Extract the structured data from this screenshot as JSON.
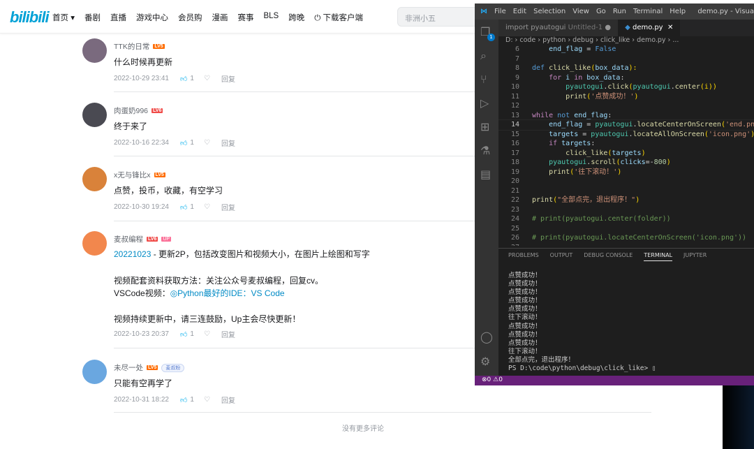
{
  "header": {
    "logo": "bilibili",
    "nav": [
      "首页 ▾",
      "番剧",
      "直播",
      "游戏中心",
      "会员购",
      "漫画",
      "赛事",
      "BLS",
      "跨晚",
      "⏻ 下载客户端"
    ],
    "search_placeholder": "非洲小五"
  },
  "comments": [
    {
      "user": "TTK的日常",
      "level": "LV5",
      "text": [
        "什么时候再更新"
      ],
      "time": "2022-10-29 23:41",
      "likes": "1",
      "reply": "回复",
      "avatar_color": "#7a6a7e"
    },
    {
      "user": "肉蛋奶996",
      "level": "LV6",
      "text": [
        "终于来了"
      ],
      "time": "2022-10-16 22:34",
      "likes": "1",
      "reply": "回复",
      "avatar_color": "#4a4a52"
    },
    {
      "user": "x无与锋比x",
      "level": "LV5",
      "text": [
        "点赞，投币，收藏，有空学习"
      ],
      "time": "2022-10-30 19:24",
      "likes": "1",
      "reply": "回复",
      "avatar_color": "#d9823a"
    },
    {
      "user": "麦叔编程",
      "level": "LV6",
      "badge": "UP",
      "text_link": "20221023",
      "text_rest": " - 更新2P，包括改变图片和视频大小，在图片上绘图和写字",
      "line2": "视频配套资料获取方法：关注公众号麦叔编程，回复cv。",
      "line3_prefix": "VSCode视频：",
      "line3_link": "◎Python最好的IDE：VS Code",
      "line4": "视频持续更新中，请三连鼓励，Up主会尽快更新！",
      "time": "2022-10-23 20:37",
      "likes": "1",
      "reply": "回复",
      "avatar_color": "#f2874d"
    },
    {
      "user": "未尽一处",
      "level": "LV5",
      "fan_badge": "麦叔粉",
      "text": [
        "只能有空再学了"
      ],
      "time": "2022-10-31 18:22",
      "likes": "1",
      "reply": "回复",
      "avatar_color": "#6aa7e0"
    }
  ],
  "no_more": "没有更多评论",
  "vscode": {
    "menu": [
      "File",
      "Edit",
      "Selection",
      "View",
      "Go",
      "Run",
      "Terminal",
      "Help"
    ],
    "title": "demo.py - Visua",
    "tabs": [
      {
        "label": "import pyautogui",
        "sub": "Untitled-1",
        "dirty": true
      },
      {
        "label": "demo.py",
        "active": true
      }
    ],
    "breadcrumb": "D: › code › python › debug › click_like › demo.py › ...",
    "explorer_badge": "1",
    "code": [
      {
        "n": "6",
        "t": [
          [
            "    end_flag",
            "vr"
          ],
          [
            " = ",
            "pl"
          ],
          [
            "False",
            "df"
          ]
        ]
      },
      {
        "n": "7",
        "t": []
      },
      {
        "n": "8",
        "t": [
          [
            "def ",
            "df"
          ],
          [
            "click_like",
            "fn"
          ],
          [
            "(",
            "br"
          ],
          [
            "box_data",
            "vr"
          ],
          [
            "):",
            "br"
          ]
        ]
      },
      {
        "n": "9",
        "t": [
          [
            "    for ",
            "kw"
          ],
          [
            "i ",
            "vr"
          ],
          [
            "in ",
            "kw"
          ],
          [
            "box_data",
            "vr"
          ],
          [
            ":",
            "pl"
          ]
        ]
      },
      {
        "n": "10",
        "t": [
          [
            "        pyautogui",
            "cn"
          ],
          [
            ".",
            "pl"
          ],
          [
            "click",
            "fn"
          ],
          [
            "(",
            "br"
          ],
          [
            "pyautogui",
            "cn"
          ],
          [
            ".",
            "pl"
          ],
          [
            "center",
            "fn"
          ],
          [
            "(i))",
            "br"
          ]
        ]
      },
      {
        "n": "11",
        "t": [
          [
            "        print",
            "fn"
          ],
          [
            "(",
            "br"
          ],
          [
            "'点赞成功！'",
            "st"
          ],
          [
            ")",
            "br"
          ]
        ]
      },
      {
        "n": "12",
        "t": []
      },
      {
        "n": "13",
        "t": [
          [
            "while ",
            "kw"
          ],
          [
            "not ",
            "df"
          ],
          [
            "end_flag",
            "vr"
          ],
          [
            ":",
            "pl"
          ]
        ]
      },
      {
        "n": "14",
        "cur": true,
        "t": [
          [
            "    end_flag",
            "vr"
          ],
          [
            " = ",
            "pl"
          ],
          [
            "pyautogui",
            "cn"
          ],
          [
            ".",
            "pl"
          ],
          [
            "locateCenterOnScreen",
            "fn"
          ],
          [
            "(",
            "br"
          ],
          [
            "'end.png'",
            "st"
          ],
          [
            ")",
            "br"
          ]
        ]
      },
      {
        "n": "15",
        "t": [
          [
            "    targets",
            "vr"
          ],
          [
            " = ",
            "pl"
          ],
          [
            "pyautogui",
            "cn"
          ],
          [
            ".",
            "pl"
          ],
          [
            "locateAllOnScreen",
            "fn"
          ],
          [
            "(",
            "br"
          ],
          [
            "'icon.png'",
            "st"
          ],
          [
            ")",
            "br"
          ]
        ]
      },
      {
        "n": "16",
        "t": [
          [
            "    if ",
            "kw"
          ],
          [
            "targets",
            "vr"
          ],
          [
            ":",
            "pl"
          ]
        ]
      },
      {
        "n": "17",
        "t": [
          [
            "        click_like",
            "fn"
          ],
          [
            "(",
            "br"
          ],
          [
            "targets",
            "vr"
          ],
          [
            ")",
            "br"
          ]
        ]
      },
      {
        "n": "18",
        "t": [
          [
            "    pyautogui",
            "cn"
          ],
          [
            ".",
            "pl"
          ],
          [
            "scroll",
            "fn"
          ],
          [
            "(",
            "br"
          ],
          [
            "clicks",
            "vr"
          ],
          [
            "=-",
            "pl"
          ],
          [
            "800",
            "nu"
          ],
          [
            ")",
            "br"
          ]
        ]
      },
      {
        "n": "19",
        "t": [
          [
            "    print",
            "fn"
          ],
          [
            "(",
            "br"
          ],
          [
            "'往下滚动！'",
            "st"
          ],
          [
            ")",
            "br"
          ]
        ]
      },
      {
        "n": "20",
        "t": []
      },
      {
        "n": "21",
        "t": []
      },
      {
        "n": "22",
        "t": [
          [
            "print",
            "fn"
          ],
          [
            "(",
            "br"
          ],
          [
            "\"全部点完，退出程序！\"",
            "st"
          ],
          [
            ")",
            "br"
          ]
        ]
      },
      {
        "n": "23",
        "t": []
      },
      {
        "n": "24",
        "t": [
          [
            "# print(pyautogui.center(folder))",
            "cm2"
          ]
        ]
      },
      {
        "n": "25",
        "t": []
      },
      {
        "n": "26",
        "t": [
          [
            "# print(pyautogui.locateCenterOnScreen('icon.png'))",
            "cm2"
          ]
        ]
      },
      {
        "n": "27",
        "t": []
      }
    ],
    "panel_tabs": [
      "PROBLEMS",
      "OUTPUT",
      "DEBUG CONSOLE",
      "TERMINAL",
      "JUPYTER"
    ],
    "active_panel": "TERMINAL",
    "terminal": [
      "点赞成功！",
      "点赞成功！",
      "点赞成功！",
      "点赞成功！",
      "点赞成功！",
      "往下滚动！",
      "点赞成功！",
      "点赞成功！",
      "点赞成功！",
      "往下滚动！",
      "全部点完，退出程序！",
      "PS D:\\code\\python\\debug\\click_like> ▯"
    ],
    "status": {
      "errors": "0",
      "warnings": "0"
    },
    "status_color": "#68217a"
  }
}
